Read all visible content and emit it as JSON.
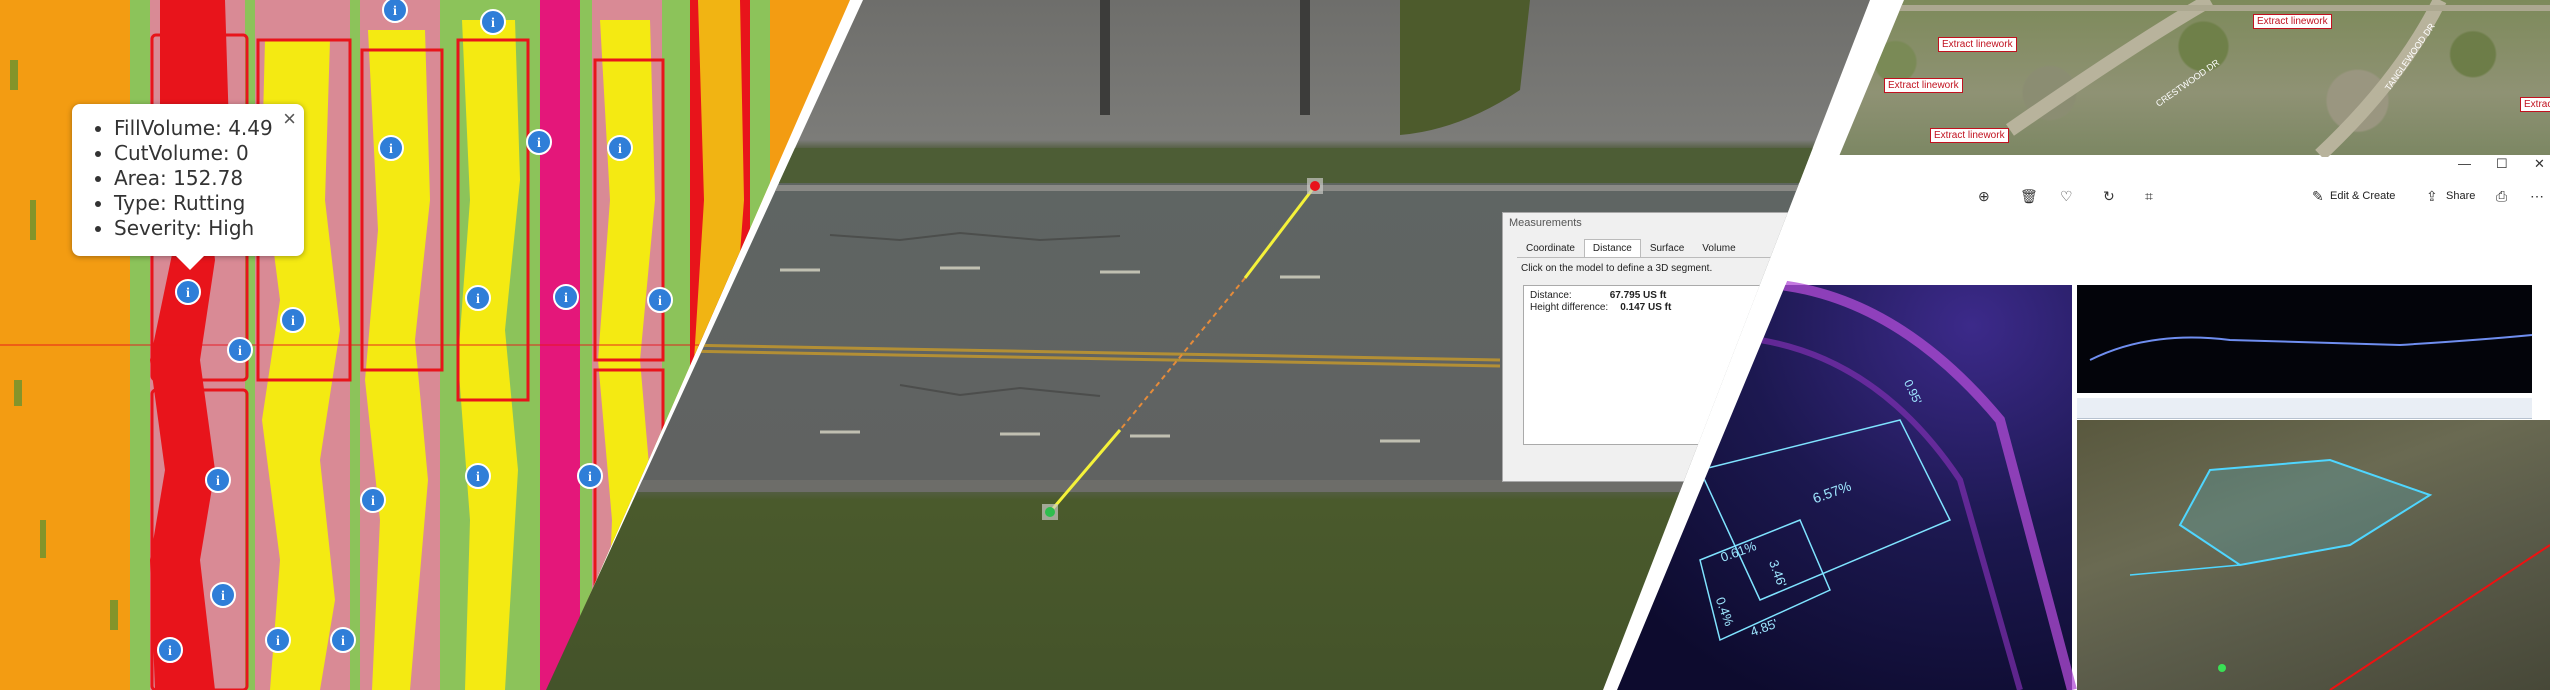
{
  "popup": {
    "close_glyph": "×",
    "items": [
      "FillVolume: 4.49",
      "CutVolume: 0",
      "Area: 152.78",
      "Type: Rutting",
      "Severity: High"
    ]
  },
  "info_marker_glyph": "i",
  "measurements": {
    "title": "Measurements",
    "tabs": [
      "Coordinate",
      "Distance",
      "Surface",
      "Volume"
    ],
    "active_tab": "Distance",
    "hint": "Click on the model to define a 3D segment.",
    "distance_label": "Distance:",
    "distance_value": "67.795 US ft",
    "height_label": "Height difference:",
    "height_value": "0.147 US ft"
  },
  "aerial_tags": [
    "Extract linework",
    "Extract linework",
    "Extract linework",
    "Extract linework",
    "Extract"
  ],
  "street_labels": [
    "CRESTWOOD DR",
    "TANGLEWOOD DR"
  ],
  "photos_toolbar": {
    "edit_create": "Edit & Create",
    "share": "Share",
    "icons": [
      "zoom-in-icon",
      "delete-icon",
      "favorite-icon",
      "rotate-icon",
      "crop-icon",
      "print-icon",
      "more-icon"
    ]
  },
  "window_controls": [
    "—",
    "☐",
    "✕"
  ],
  "pointcloud_labels": [
    "6.57%",
    "0.61%",
    "3.46'",
    "0.4%",
    "4.85'",
    "0.95'"
  ],
  "colors": {
    "heat_orange": "#f39c12",
    "heat_red": "#e8141b",
    "heat_yellow": "#f4ea12",
    "heat_green": "#8cc35a",
    "heat_pink": "#d98a95",
    "heat_magenta": "#e4177a",
    "info_blue": "#2f7ed8",
    "measure_line": "#f5f23a",
    "tag_red": "#c1121f"
  }
}
